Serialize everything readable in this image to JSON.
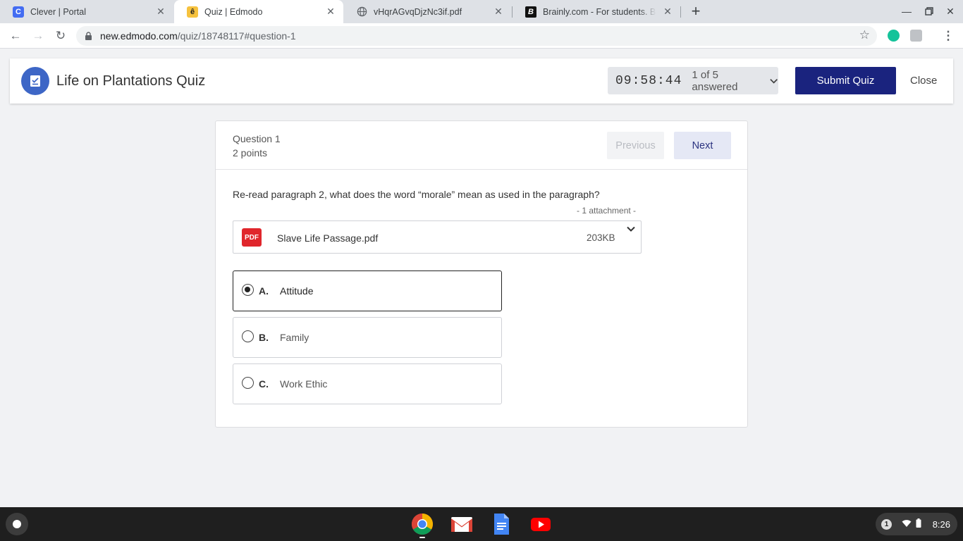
{
  "browser": {
    "tabs": [
      {
        "title": "Clever | Portal",
        "icon": "clever-icon",
        "glyph": "C"
      },
      {
        "title": "Quiz | Edmodo",
        "icon": "edmodo-icon",
        "glyph": "ê"
      },
      {
        "title": "vHqrAGvqDjzNc3if.pdf",
        "icon": "globe-icon",
        "glyph": ""
      },
      {
        "title": "Brainly.com - For students. By students.",
        "icon": "brainly-icon",
        "glyph": "B"
      }
    ],
    "url_host": "new.edmodo.com",
    "url_path": "/quiz/18748117#question-1"
  },
  "quiz": {
    "title": "Life on Plantations Quiz",
    "timer": "09:58:44",
    "answered": "1 of 5 answered",
    "submit_label": "Submit Quiz",
    "close_label": "Close"
  },
  "question": {
    "number_label": "Question 1",
    "points_label": "2 points",
    "prev_label": "Previous",
    "next_label": "Next",
    "prompt": "Re-read paragraph 2, what does the word “morale” mean as used in the paragraph?",
    "attachment_count": "- 1 attachment  -",
    "attachment": {
      "type_label": "PDF",
      "name": "Slave Life Passage.pdf",
      "size": "203KB"
    },
    "options": [
      {
        "letter": "A.",
        "text": "Attitude",
        "selected": true
      },
      {
        "letter": "B.",
        "text": "Family",
        "selected": false
      },
      {
        "letter": "C.",
        "text": "Work Ethic",
        "selected": false
      }
    ]
  },
  "shelf": {
    "apps": [
      "chrome-icon",
      "gmail-icon",
      "docs-icon",
      "youtube-icon"
    ],
    "notification_count": "1",
    "time": "8:26"
  },
  "colors": {
    "primary": "#1a237e",
    "quiz_icon": "#3d66c6",
    "pdf": "#e0262c"
  }
}
